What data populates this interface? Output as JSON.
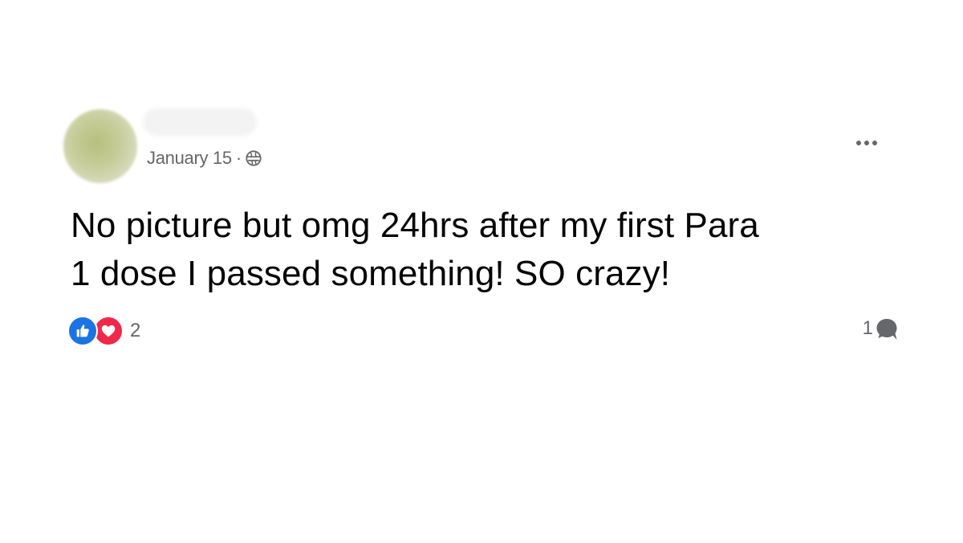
{
  "post": {
    "date": "January 15",
    "separator": "·",
    "audience_icon": "globe-icon",
    "more_icon": "more-options-icon",
    "text_line1": "No picture but omg 24hrs after my first Para",
    "text_line2": "1 dose I passed something! SO crazy!",
    "reactions": {
      "types": [
        "like-icon",
        "love-icon"
      ],
      "count": "2"
    },
    "comments": {
      "count": "1",
      "icon": "comment-icon"
    }
  },
  "colors": {
    "like": "#1b74e4",
    "love": "#f02849",
    "secondary_text": "#65676b",
    "primary_text": "#050505"
  }
}
